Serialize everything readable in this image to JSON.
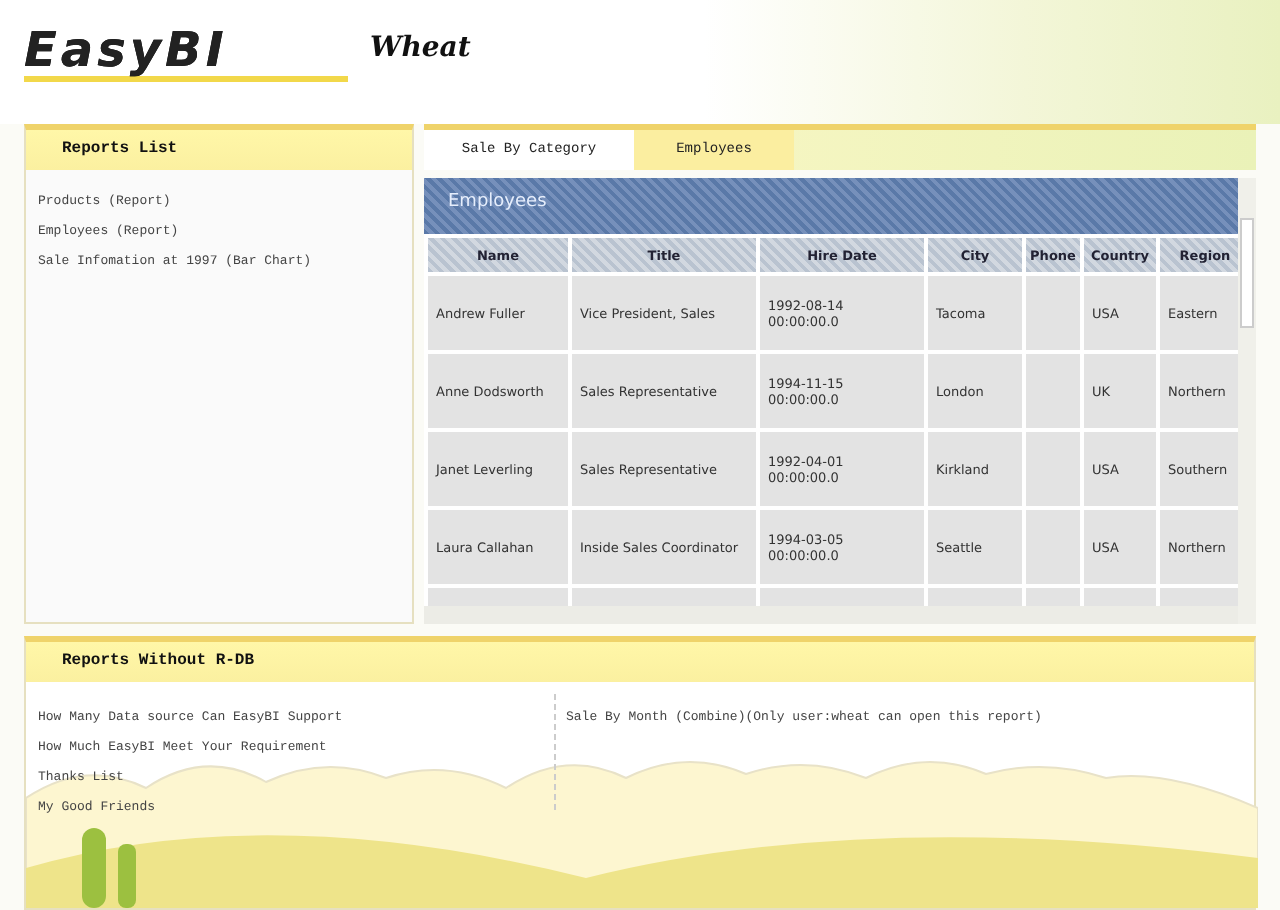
{
  "header": {
    "logo": "EasyBI",
    "user": "Wheat"
  },
  "reports_list": {
    "title": "Reports List",
    "items": [
      "Products (Report)",
      "Employees (Report)",
      "Sale Infomation at 1997 (Bar Chart)"
    ]
  },
  "tabs": [
    {
      "label": "Sale By Category",
      "selected": false
    },
    {
      "label": "Employees",
      "selected": true
    }
  ],
  "table": {
    "title": "Employees",
    "columns": [
      "Name",
      "Title",
      "Hire Date",
      "City",
      "Phone",
      "Country",
      "Region"
    ],
    "rows": [
      [
        "Andrew Fuller",
        "Vice President, Sales",
        "1992-08-14 00:00:00.0",
        "Tacoma",
        "",
        "USA",
        "Eastern"
      ],
      [
        "Anne Dodsworth",
        "Sales Representative",
        "1994-11-15 00:00:00.0",
        "London",
        "",
        "UK",
        "Northern"
      ],
      [
        "Janet Leverling",
        "Sales Representative",
        "1992-04-01 00:00:00.0",
        "Kirkland",
        "",
        "USA",
        "Southern"
      ],
      [
        "Laura Callahan",
        "Inside Sales Coordinator",
        "1994-03-05 00:00:00.0",
        "Seattle",
        "",
        "USA",
        "Northern"
      ]
    ]
  },
  "reports_without_rdb": {
    "title": "Reports Without R-DB",
    "left_items": [
      "How Many Data source Can EasyBI Support",
      "How Much EasyBI Meet Your Requirement",
      "Thanks List",
      "My Good Friends"
    ],
    "right_items": [
      "Sale By Month (Combine)(Only user:wheat can open this report)"
    ]
  }
}
